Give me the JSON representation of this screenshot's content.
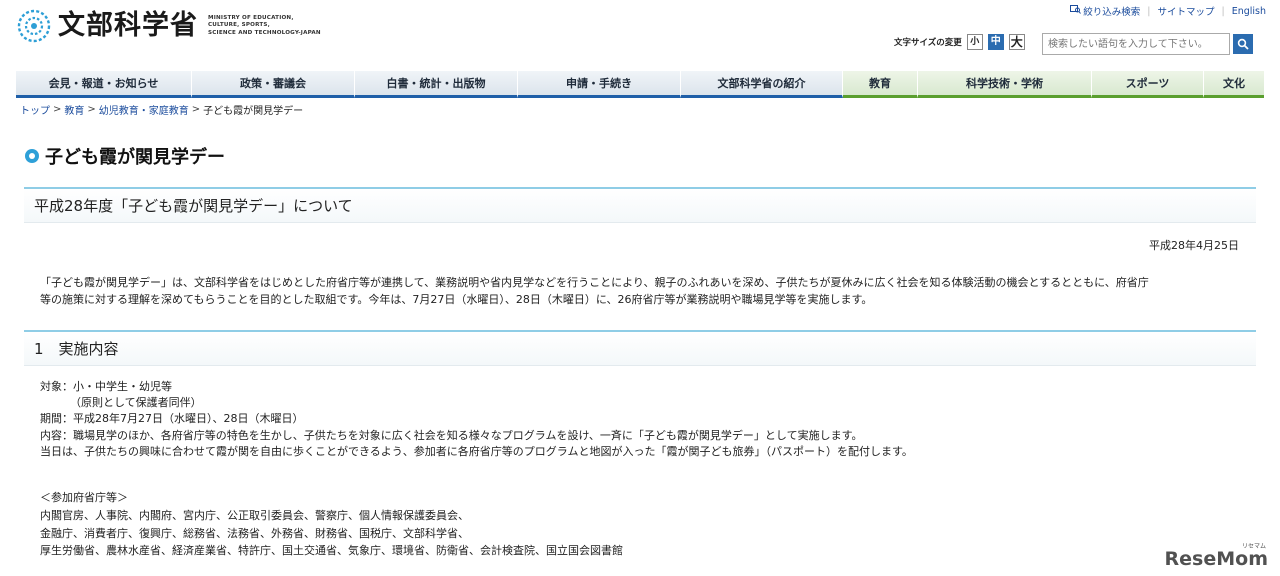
{
  "header": {
    "logo_jp": "文部科学省",
    "logo_en": [
      "MINISTRY OF EDUCATION,",
      "CULTURE, SPORTS,",
      "SCIENCE AND TECHNOLOGY-JAPAN"
    ],
    "util_links": [
      "絞り込み検索",
      "サイトマップ",
      "English"
    ],
    "font_size_label": "文字サイズの変更",
    "font_size_small": "小",
    "font_size_medium": "中",
    "font_size_large": "大",
    "search_placeholder": "検索したい語句を入力して下さい。"
  },
  "nav": {
    "items": [
      {
        "label": "会見・報道・お知らせ"
      },
      {
        "label": "政策・審議会"
      },
      {
        "label": "白書・統計・出版物"
      },
      {
        "label": "申請・手続き"
      },
      {
        "label": "文部科学省の紹介"
      },
      {
        "label": "教育"
      },
      {
        "label": "科学技術・学術"
      },
      {
        "label": "スポーツ"
      },
      {
        "label": "文化"
      }
    ]
  },
  "breadcrumb": {
    "items": [
      "トップ",
      "教育",
      "幼児教育・家庭教育"
    ],
    "current": "子ども霞が関見学デー"
  },
  "page": {
    "title": "子ども霞が関見学デー",
    "section1_title": "平成28年度「子ども霞が関見学デー」について",
    "date": "平成28年4月25日",
    "intro_line1": "「子ども霞が関見学デー」は、文部科学省をはじめとした府省庁等が連携して、業務説明や省内見学などを行うことにより、親子のふれあいを深め、子供たちが夏休みに広く社会を知る体験活動の機会とするとともに、府省庁",
    "intro_line2": "等の施策に対する理解を深めてもらうことを目的とした取組です。今年は、7月27日（水曜日）、28日（木曜日）に、26府省庁等が業務説明や職場見学等を実施します。",
    "section2_title": "1　実施内容",
    "target_line1": "対象：小・中学生・幼児等",
    "target_line2": "（原則として保護者同伴）",
    "period": "期間：平成28年7月27日（水曜日）、28日（木曜日）",
    "content": "内容：職場見学のほか、各府省庁等の特色を生かし、子供たちを対象に広く社会を知る様々なプログラムを設け、一斉に「子ども霞が関見学デー」として実施します。",
    "day_note": "当日は、子供たちの興味に合わせて霞が関を自由に歩くことができるよう、参加者に各府省庁等のプログラムと地図が入った「霞が関子ども旅券」（パスポート）を配付します。",
    "orgs_heading": "＜参加府省庁等＞",
    "orgs_line1": "内閣官房、人事院、内閣府、宮内庁、公正取引委員会、警察庁、個人情報保護委員会、",
    "orgs_line2": "金融庁、消費者庁、復興庁、総務省、法務省、外務省、財務省、国税庁、文部科学省、",
    "orgs_line3": "厚生労働省、農林水産省、経済産業省、特許庁、国土交通省、気象庁、環境省、防衛省、会計検査院、国立国会図書館"
  },
  "watermark": {
    "brand": "ReseMom",
    "sub": "リセマム"
  },
  "colors": {
    "nav_blue": "#1f5fa8",
    "nav_green": "#5a9f2e",
    "accent": "#2ea0d8",
    "link": "#1a4b9c"
  }
}
